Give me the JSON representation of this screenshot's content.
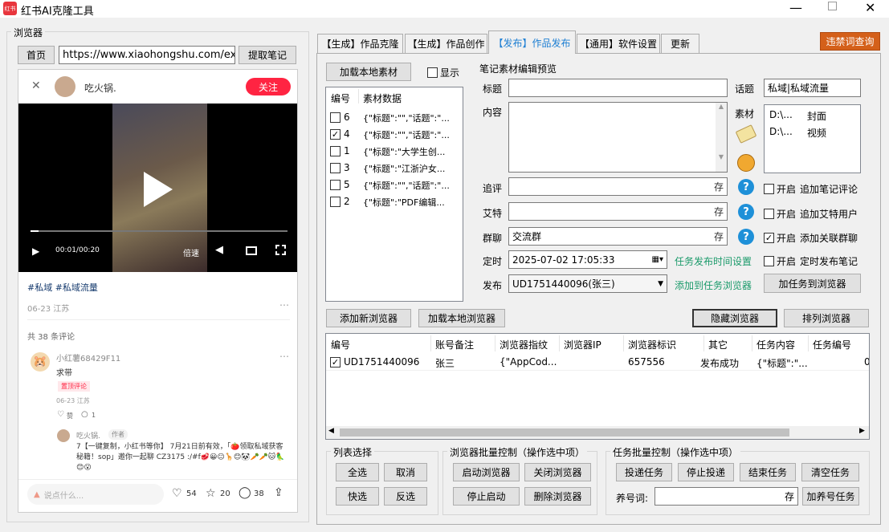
{
  "window": {
    "title": "红书AI克隆工具",
    "logo_text": "红书"
  },
  "browser": {
    "group_title": "浏览器",
    "home_label": "首页",
    "url": "https://www.xiaohongshu.com/explor",
    "extract_label": "提取笔记"
  },
  "note": {
    "author": "吃火锅.",
    "follow_label": "关注",
    "video_time": "00:01/00:20",
    "speed_label": "倍速",
    "tags": "#私域 #私域流量",
    "date": "06-23 江苏",
    "comment_count": "共 38 条评论",
    "c1_user": "小红薯68429F11",
    "c1_text": "求带",
    "c1_badge": "置顶评论",
    "c1_date": "06-23 江苏",
    "c1_like": "赞",
    "c1_reply": "1",
    "c2_user": "吃火锅.",
    "c2_tag": "作者",
    "c2_text": "7【一键复制，小红书等你】 7月21日前有效，「🍅领取私域获客秘籍！sop」邀你一起聊 CZ3175 :/#f🥩😀😐🦒😊🐼🥕🥕🐱🦜😊😮",
    "input_placeholder": "说点什么...",
    "likes": "54",
    "stars": "20",
    "comments": "38"
  },
  "tabs": [
    "【生成】作品克隆",
    "【生成】作品创作",
    "【发布】作品发布",
    "【通用】软件设置",
    "更新"
  ],
  "violation_btn": "违禁词查询",
  "material": {
    "load_btn": "加载本地素材",
    "show_label": "显示",
    "col_id": "编号",
    "col_data": "素材数据",
    "rows": [
      {
        "id": "6",
        "data": "{\"标题\":\"\",\"话题\":\"...",
        "checked": false
      },
      {
        "id": "4",
        "data": "{\"标题\":\"\",\"话题\":\"...",
        "checked": true
      },
      {
        "id": "1",
        "data": "{\"标题\":\"大学生创...",
        "checked": false
      },
      {
        "id": "3",
        "data": "{\"标题\":\"江浙沪女...",
        "checked": false
      },
      {
        "id": "5",
        "data": "{\"标题\":\"\",\"话题\":\"...",
        "checked": false
      },
      {
        "id": "2",
        "data": "{\"标题\":\"PDF编辑...",
        "checked": false
      }
    ]
  },
  "preview": {
    "group_title": "笔记素材编辑预览",
    "title_label": "标题",
    "topic_label": "话题",
    "topic_value": "私域|私域流量",
    "content_label": "内容",
    "material_label": "素材",
    "materials": [
      {
        "path": "D:\\...",
        "type": "封面"
      },
      {
        "path": "D:\\...",
        "type": "视频"
      }
    ],
    "comment_label": "追评",
    "at_label": "艾特",
    "group_label": "群聊",
    "group_value": "交流群",
    "save": "存",
    "timer_label": "定时",
    "timer_value": "2025-07-02 17:05:33",
    "timer_link": "任务发布时间设置",
    "publish_label": "发布",
    "publish_value": "UD1751440096(张三)",
    "publish_link": "添加到任务浏览器",
    "add_task_btn": "加任务到浏览器",
    "opt1_a": "开启",
    "opt1_b": "追加笔记评论",
    "opt2_a": "开启",
    "opt2_b": "追加艾特用户",
    "opt3_a": "开启",
    "opt3_b": "添加关联群聊",
    "opt4_a": "开启",
    "opt4_b": "定时发布笔记"
  },
  "browser_bar": {
    "add_new": "添加新浏览器",
    "load_local": "加载本地浏览器",
    "hide": "隐藏浏览器",
    "arrange": "排列浏览器"
  },
  "grid": {
    "headers": [
      "编号",
      "账号备注",
      "浏览器指纹",
      "浏览器IP",
      "浏览器标识",
      "其它",
      "任务内容",
      "任务编号"
    ],
    "row": {
      "id": "UD1751440096",
      "remark": "张三",
      "fp": "{\"AppCod...",
      "ip": "",
      "mark": "657556",
      "other": "发布成功",
      "content": "{\"标题\":\"...",
      "task_no": "0"
    }
  },
  "list_sel": {
    "title": "列表选择",
    "all": "全选",
    "cancel": "取消",
    "quick": "快选",
    "invert": "反选"
  },
  "batch_browser": {
    "title": "浏览器批量控制（操作选中项）",
    "start": "启动浏览器",
    "close": "关闭浏览器",
    "stop": "停止启动",
    "delete": "删除浏览器"
  },
  "batch_task": {
    "title": "任务批量控制（操作选中项）",
    "deliver": "投递任务",
    "stop": "停止投递",
    "end": "结束任务",
    "clear": "清空任务",
    "keyword_label": "养号词:",
    "save": "存",
    "add_task": "加养号任务"
  }
}
